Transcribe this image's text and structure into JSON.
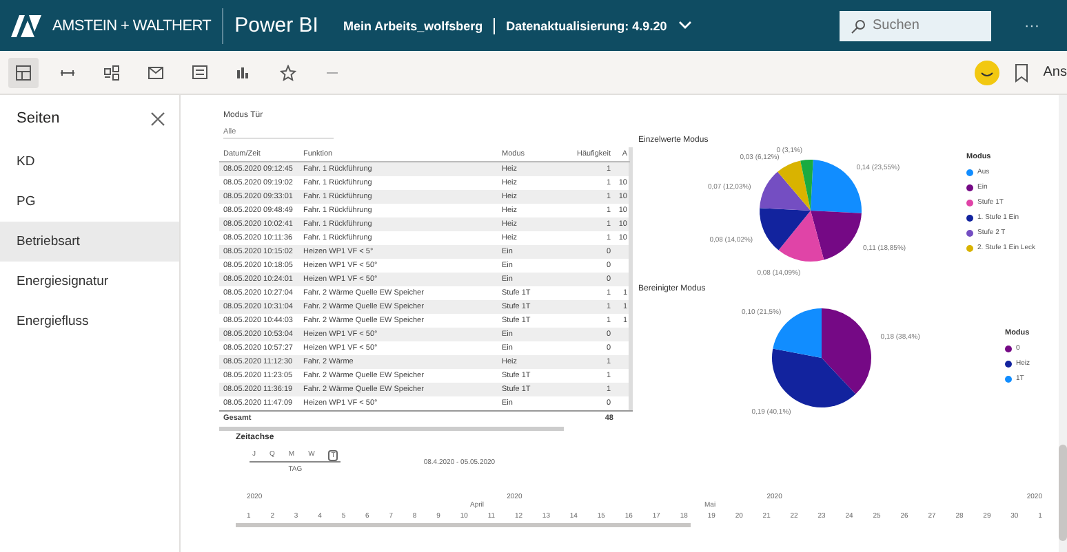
{
  "header": {
    "logo": "AMSTEIN + WALTHERT",
    "app": "Power BI",
    "workspace": "Mein Arbeits_wolfsberg",
    "refresh": "Datenaktualisierung: 4.9.20",
    "search": {
      "placeholder": "Suchen"
    },
    "more": "···"
  },
  "toolbar": {
    "right_label": "Ans"
  },
  "sidebar": {
    "title": "Seiten",
    "items": [
      {
        "label": "KD",
        "selected": false
      },
      {
        "label": "PG",
        "selected": false
      },
      {
        "label": "Betriebsart",
        "selected": true
      },
      {
        "label": "Energiesignatur",
        "selected": false
      },
      {
        "label": "Energiefluss",
        "selected": false
      }
    ]
  },
  "table": {
    "title": "Modus Tür",
    "slicer": "Alle",
    "columns": [
      "Datum/Zeit",
      "Funktion",
      "Modus",
      "Häufigkeit",
      "A"
    ],
    "rows": [
      [
        "08.05.2020 09:12:45",
        "Fahr. 1 Rückführung",
        "Heiz",
        "1",
        ""
      ],
      [
        "08.05.2020 09:19:02",
        "Fahr. 1 Rückführung",
        "Heiz",
        "1",
        "10"
      ],
      [
        "08.05.2020 09:33:01",
        "Fahr. 1 Rückführung",
        "Heiz",
        "1",
        "10"
      ],
      [
        "08.05.2020 09:48:49",
        "Fahr. 1 Rückführung",
        "Heiz",
        "1",
        "10"
      ],
      [
        "08.05.2020 10:02:41",
        "Fahr. 1 Rückführung",
        "Heiz",
        "1",
        "10"
      ],
      [
        "08.05.2020 10:11:36",
        "Fahr. 1 Rückführung",
        "Heiz",
        "1",
        "10"
      ],
      [
        "08.05.2020 10:15:02",
        "Heizen WP1 VF < 5°",
        "Ein",
        "0",
        ""
      ],
      [
        "08.05.2020 10:18:05",
        "Heizen WP1 VF < 50°",
        "Ein",
        "0",
        ""
      ],
      [
        "08.05.2020 10:24:01",
        "Heizen WP1 VF < 50°",
        "Ein",
        "0",
        ""
      ],
      [
        "08.05.2020 10:27:04",
        "Fahr. 2 Wärme Quelle EW Speicher",
        "Stufe 1T",
        "1",
        "1"
      ],
      [
        "08.05.2020 10:31:04",
        "Fahr. 2 Wärme Quelle EW Speicher",
        "Stufe 1T",
        "1",
        "1"
      ],
      [
        "08.05.2020 10:44:03",
        "Fahr. 2 Wärme Quelle EW Speicher",
        "Stufe 1T",
        "1",
        "1"
      ],
      [
        "08.05.2020 10:53:04",
        "Heizen WP1 VF < 50°",
        "Ein",
        "0",
        ""
      ],
      [
        "08.05.2020 10:57:27",
        "Heizen WP1 VF < 50°",
        "Ein",
        "0",
        ""
      ],
      [
        "08.05.2020 11:12:30",
        "Fahr. 2 Wärme",
        "Heiz",
        "1",
        ""
      ],
      [
        "08.05.2020 11:23:05",
        "Fahr. 2 Wärme Quelle EW Speicher",
        "Stufe 1T",
        "1",
        ""
      ],
      [
        "08.05.2020 11:36:19",
        "Fahr. 2 Wärme Quelle EW Speicher",
        "Stufe 1T",
        "1",
        ""
      ],
      [
        "08.05.2020 11:47:09",
        "Heizen WP1 VF < 50°",
        "Ein",
        "0",
        ""
      ]
    ],
    "total": {
      "label": "Gesamt",
      "value": "48"
    }
  },
  "charts": [
    {
      "title": "Einzelwerte Modus",
      "legend_title": "Modus",
      "labels": [
        "0 (3,1%)",
        "0,03 (6,12%)",
        "0,14 (23,55%)",
        "0,07 (12,03%)",
        "0,08 (14,02%)",
        "0,11 (18,85%)",
        "0,08 (14,09%)"
      ],
      "legend": [
        {
          "label": "Aus",
          "color": "#118dff"
        },
        {
          "label": "Ein",
          "color": "#750985"
        },
        {
          "label": "Stufe 1T",
          "color": "#e044a7"
        },
        {
          "label": "1. Stufe 1 Ein",
          "color": "#12239e"
        },
        {
          "label": "Stufe 2 T",
          "color": "#744ec2"
        },
        {
          "label": "2. Stufe 1 Ein Leck",
          "color": "#d9b300"
        }
      ]
    },
    {
      "title": "Bereinigter Modus",
      "legend_title": "Modus",
      "labels": [
        "0,10 (21,5%)",
        "0,18 (38,4%)",
        "0,19 (40,1%)"
      ],
      "legend": [
        {
          "label": "0",
          "color": "#750985"
        },
        {
          "label": "Heiz",
          "color": "#12239e"
        },
        {
          "label": "1T",
          "color": "#118dff"
        }
      ]
    }
  ],
  "timeline": {
    "title": "Zeitachse",
    "granularity": [
      {
        "label": "J",
        "selected": false
      },
      {
        "label": "Q",
        "selected": false
      },
      {
        "label": "M",
        "selected": false
      },
      {
        "label": "W",
        "selected": false
      },
      {
        "label": "T",
        "selected": true
      }
    ],
    "granularity_label": "TAG",
    "range": "08.4.2020 - 05.05.2020",
    "years": [
      "2020",
      "2020",
      "2020",
      "2020"
    ],
    "months": [
      "April",
      "Mai"
    ],
    "days": [
      "1",
      "2",
      "3",
      "4",
      "5",
      "6",
      "7",
      "8",
      "9",
      "10",
      "11",
      "12",
      "13",
      "14",
      "15",
      "16",
      "17",
      "18",
      "19",
      "20",
      "21",
      "22",
      "23",
      "24",
      "25",
      "26",
      "27",
      "28",
      "29",
      "30",
      "1"
    ]
  }
}
